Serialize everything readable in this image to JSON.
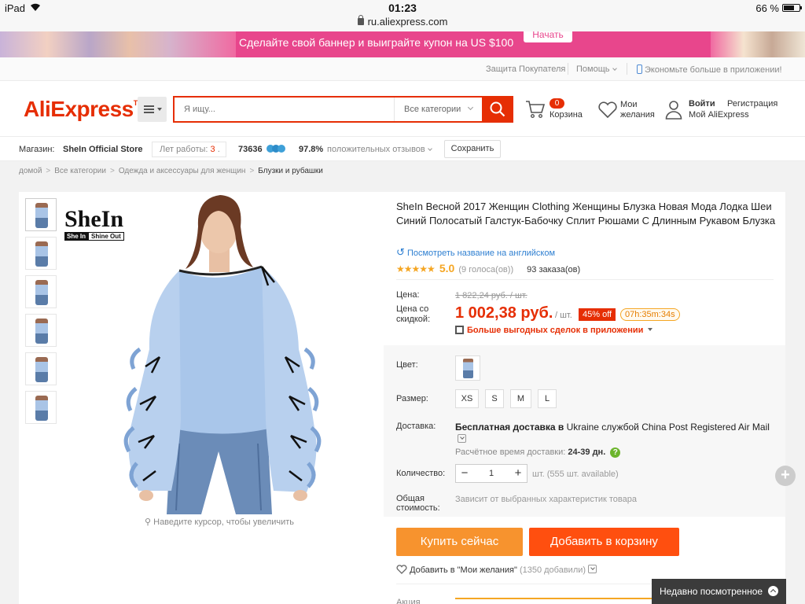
{
  "status_bar": {
    "device": "iPad",
    "time": "01:23",
    "url": "ru.aliexpress.com",
    "battery": "66 %"
  },
  "banner": {
    "text": "Сделайте свой баннер и выиграйте купон на US $100",
    "button": "Начать",
    "color": "#e8468c"
  },
  "top_links": {
    "buyer_protection": "Защита Покупателя",
    "help": "Помощь",
    "app": "Экономьте больше в приложении!"
  },
  "header": {
    "logo": "AliExpress",
    "logo_tm": "TM",
    "search_placeholder": "Я ищу...",
    "search_category": "Все категории",
    "cart_count": "0",
    "cart_label": "Корзина",
    "wish_label": "Мои желания",
    "login": "Войти",
    "register": "Регистрация",
    "my_account": "Мой AliExpress",
    "accent": "#e62e04"
  },
  "store": {
    "label": "Магазин:",
    "name": "SheIn Official Store",
    "years_label": "Лет работы:",
    "years_value": "3",
    "score": "73636",
    "positive_pct": "97.8%",
    "positive_label": "положительных отзывов",
    "save_btn": "Сохранить"
  },
  "breadcrumb": [
    "домой",
    "Все категории",
    "Одежда и аксессуары для женщин",
    "Блузки и рубашки"
  ],
  "gallery": {
    "brand_word": "SheIn",
    "brand_tag_a": "She In",
    "brand_tag_b": "Shine Out",
    "zoom_hint": "Наведите курсор, чтобы увеличить",
    "thumb_count": 6
  },
  "product": {
    "title": "SheIn Весной 2017 Женщин Clothing Женщины Блузка Новая Мода Лодка Шеи Синий Полосатый Галстук-Бабочку Сплит Рюшами С Длинным Рукавом Блузка",
    "translate": "Посмотреть название на английском",
    "stars": "★★★★★",
    "rating": "5.0",
    "votes": "(9 голоса(ов))",
    "orders": "93 заказа(ов)",
    "price_label": "Цена:",
    "old_price": "1 822,24 руб. / шт.",
    "discount_label": "Цена со скидкой:",
    "new_price": "1 002,38 руб.",
    "unit": "/ шт.",
    "off": "45% off",
    "timer": "07h:35m:34s",
    "app_deal": "Больше выгодных сделок в приложении",
    "color_label": "Цвет:",
    "size_label": "Размер:",
    "sizes": [
      "XS",
      "S",
      "M",
      "L"
    ],
    "delivery_label": "Доставка:",
    "delivery_bold": "Бесплатная доставка в",
    "delivery_rest": "Ukraine службой China Post Registered Air Mail",
    "delivery_time_label": "Расчётное время доставки:",
    "delivery_time": "24-39 дн.",
    "qty_label": "Количество:",
    "qty": "1",
    "available": "шт. (555 шт. available)",
    "total_label": "Общая стоимость:",
    "total_note": "Зависит от выбранных характеристик товара",
    "buy_now": "Купить сейчас",
    "add_to_cart": "Добавить в корзину",
    "add_wish": "Добавить в \"Мои желания\"",
    "wish_count": "(1350 добавили)",
    "promo_label": "Акция"
  },
  "recently_viewed": "Недавно посмотренное"
}
